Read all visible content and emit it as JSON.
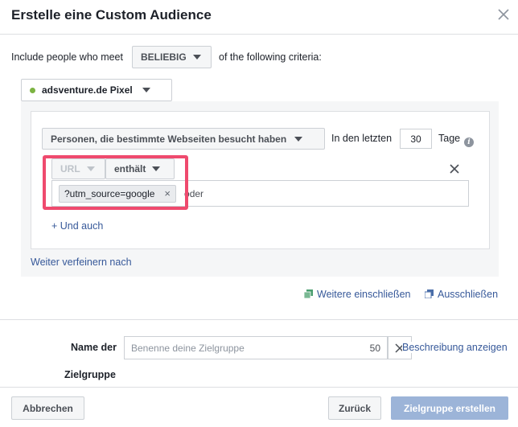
{
  "dialog": {
    "title": "Erstelle eine Custom Audience"
  },
  "criteria": {
    "prefix": "Include people who meet",
    "match_value": "BELIEBIG",
    "suffix": "of the following criteria:"
  },
  "pixel": {
    "label": "adsventure.de Pixel",
    "status_color": "#7cb342"
  },
  "rule": {
    "event_select": "Personen, die bestimmte Webseiten besucht haben",
    "days_prefix": "In den letzten",
    "days_value": "30",
    "days_suffix": "Tage",
    "field_select": "URL",
    "operator_select": "enthält",
    "token": "?utm_source=google",
    "input_trailing_text": "oder",
    "and_also": "+ Und auch"
  },
  "refine_link": "Weiter verfeinern nach",
  "include_more": "Weitere einschließen",
  "exclude": "Ausschließen",
  "name_section": {
    "label_line1": "Name der",
    "label_line2": "Zielgruppe",
    "placeholder": "Benenne deine Zielgruppe",
    "char_count": "50",
    "description_link": "Beschreibung anzeigen"
  },
  "footer": {
    "cancel": "Abbrechen",
    "back": "Zurück",
    "create": "Zielgruppe erstellen"
  },
  "colors": {
    "highlight": "#ef4a6e",
    "link": "#365899",
    "primary_disabled": "#9cb4d8"
  }
}
